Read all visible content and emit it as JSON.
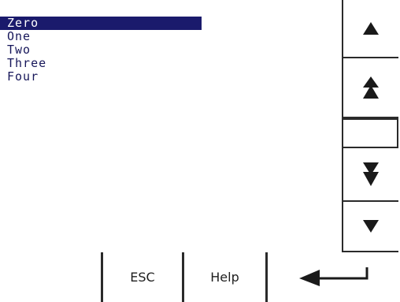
{
  "list": {
    "items": [
      {
        "label": "Zero"
      },
      {
        "label": "One"
      },
      {
        "label": "Two"
      },
      {
        "label": "Three"
      },
      {
        "label": "Four"
      }
    ],
    "selected_index": 0
  },
  "side_buttons": {
    "up_icon": "arrow-up-icon",
    "page_up_icon": "double-arrow-up-icon",
    "page_down_icon": "double-arrow-down-icon",
    "down_icon": "arrow-down-icon"
  },
  "bottom_buttons": {
    "esc_label": "ESC",
    "help_label": "Help",
    "enter_icon": "enter-arrow-icon"
  },
  "colors": {
    "selection_background": "#1a1a6c",
    "selection_text": "#ffffff",
    "list_text": "#17175a",
    "border": "#2a2a2a"
  }
}
